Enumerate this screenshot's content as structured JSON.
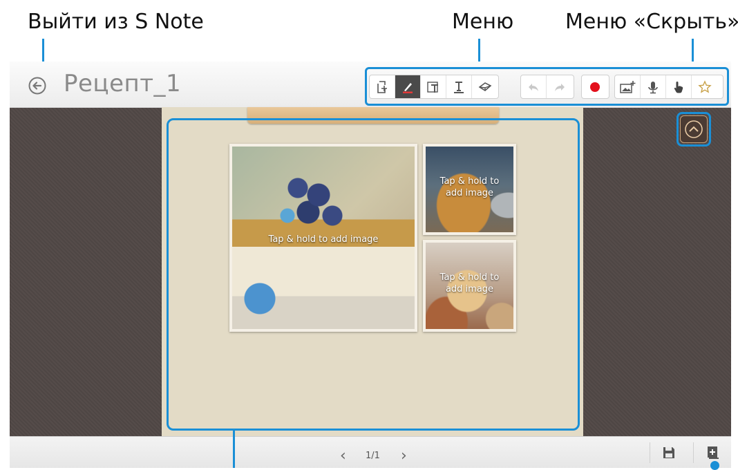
{
  "callouts": {
    "exit": "Выйти из S Note",
    "menu": "Меню",
    "hide_menu": "Меню «Скрыть»"
  },
  "titlebar": {
    "title": "Рецепт_1"
  },
  "toolbar": {
    "groups": [
      [
        "page-add-icon",
        "pen-icon",
        "text-box-icon",
        "text-icon",
        "eraser-icon"
      ],
      [
        "undo-icon",
        "redo-icon"
      ],
      [
        "record-icon"
      ],
      [
        "add-image-icon",
        "microphone-icon",
        "hand-icon",
        "star-icon"
      ]
    ],
    "active": "pen-icon"
  },
  "photos": {
    "large_caption": "Tap & hold to add image",
    "small_top_caption_1": "Tap & hold to",
    "small_top_caption_2": "add image",
    "small_bottom_caption_1": "Tap & hold to",
    "small_bottom_caption_2": "add image"
  },
  "bottombar": {
    "prev": "‹",
    "page_indicator": "1/1",
    "next": "›"
  },
  "colors": {
    "accent": "#1a8fd6",
    "background": "#4d4543",
    "page": "#e3dbc6"
  }
}
